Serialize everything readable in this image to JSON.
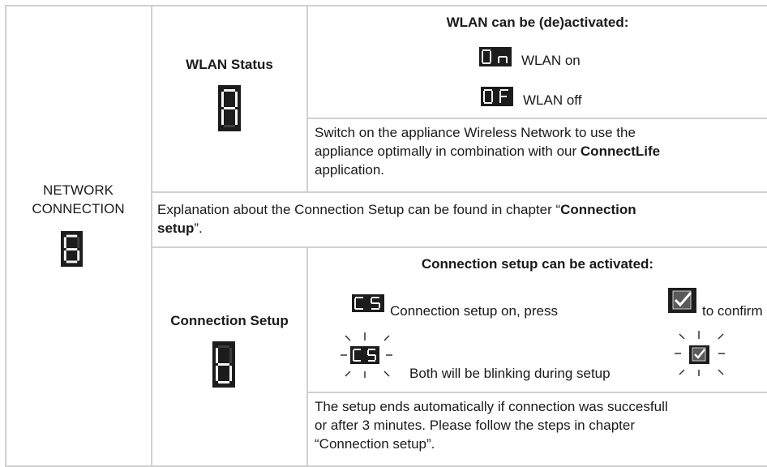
{
  "network": {
    "title_line1": "NETWORK",
    "title_line2": "CONNECTION",
    "digit": "6"
  },
  "wlan": {
    "title": "WLAN Status",
    "digit": "A",
    "header": "WLAN can be (de)activated:",
    "on_code": "On",
    "on_label": "WLAN on",
    "off_code": "OF",
    "off_label": "WLAN off",
    "desc_line1": "Switch on the appliance Wireless Network to use the",
    "desc_line2_pre": "appliance optimally in combination with our ",
    "desc_line2_bold": "ConnectLife",
    "desc_line3": "application."
  },
  "explanation": {
    "pre": "Explanation about the Connection Setup can be found in chapter “",
    "bold1": "Connection",
    "bold2": "setup",
    "post": "”."
  },
  "connection": {
    "title": "Connection Setup",
    "digit": "b",
    "header": "Connection setup can be activated:",
    "cs_code": "CS",
    "line1_pre": "Connection setup on, press",
    "line1_post": "to confirm",
    "blink_label": "Both will be blinking during setup",
    "end_line1": "The setup ends automatically if connection was succesfull",
    "end_line2": "or after 3 minutes. Please follow the steps in chapter",
    "end_line3": "“Connection setup”."
  }
}
